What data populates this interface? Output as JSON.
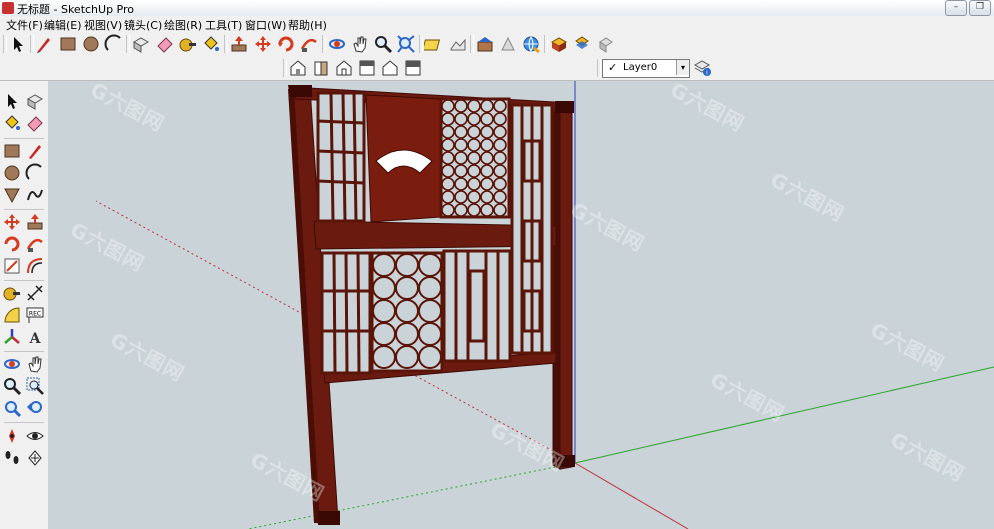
{
  "window": {
    "title": "无标题 - SketchUp Pro",
    "controls": {
      "minimize": "–",
      "restore": "❐"
    }
  },
  "menu": {
    "items": [
      "文件(F)",
      "编辑(E)",
      "视图(V)",
      "镜头(C)",
      "绘图(R)",
      "工具(T)",
      "窗口(W)",
      "帮助(H)"
    ]
  },
  "layers": {
    "current": "Layer0",
    "check": "✓",
    "arrow": "▾"
  },
  "watermark": {
    "text": "六图网",
    "mark": "G"
  },
  "colors": {
    "wood": "#6b1a0f",
    "wood_dark": "#4a0e06",
    "axis_red": "#c0303a",
    "axis_green": "#2aa52a",
    "axis_blue": "#2b3cc4",
    "sky": "#c9d3d8"
  }
}
